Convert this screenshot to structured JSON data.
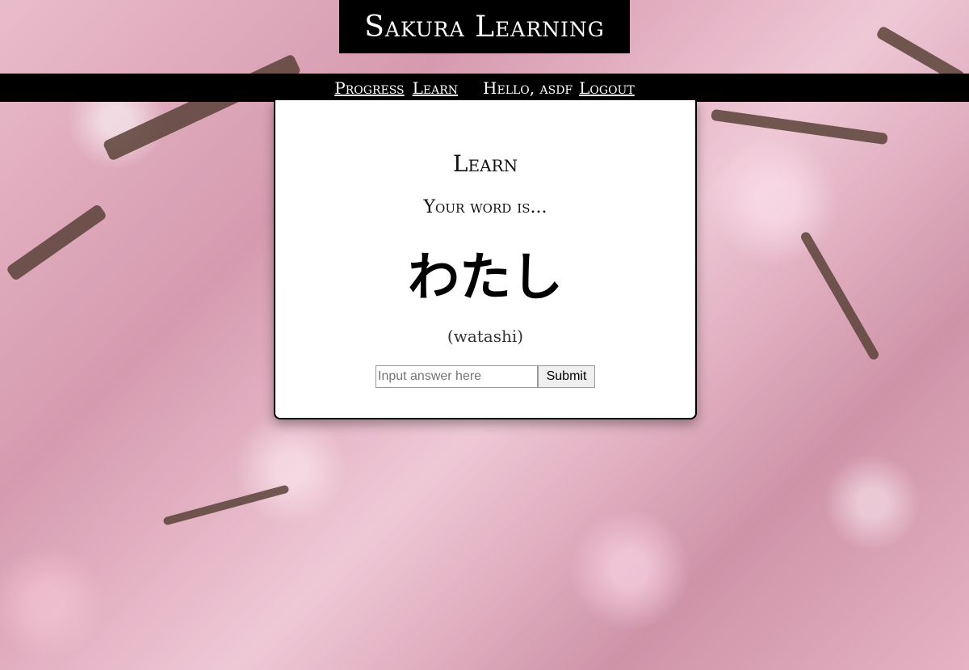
{
  "site": {
    "title": "Sakura Learning"
  },
  "nav": {
    "progress_label": "Progress",
    "learn_label": "Learn",
    "greeting": "Hello, asdf",
    "logout_label": "Logout"
  },
  "card": {
    "heading": "Learn",
    "subheading": "Your word is...",
    "word": "わたし",
    "romaji": "(watashi)"
  },
  "form": {
    "placeholder": "Input answer here",
    "submit_label": "Submit"
  }
}
